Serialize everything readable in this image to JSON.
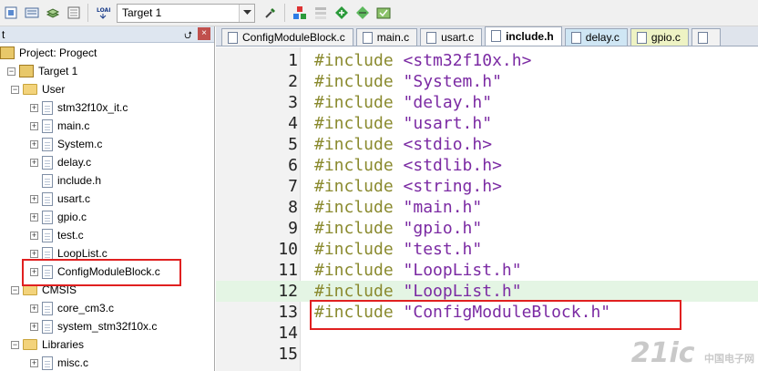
{
  "toolbar": {
    "target_select": "Target 1"
  },
  "panel": {
    "title": "t",
    "pin": "⮍",
    "close": "×",
    "tree": [
      {
        "label": "Project: Progect",
        "level": 0,
        "kind": "project",
        "exp": ""
      },
      {
        "label": "Target 1",
        "level": 1,
        "kind": "project",
        "exp": "−"
      },
      {
        "label": "User",
        "level": 2,
        "kind": "folder",
        "exp": "−"
      },
      {
        "label": "stm32f10x_it.c",
        "level": 3,
        "kind": "file",
        "exp": "+"
      },
      {
        "label": "main.c",
        "level": 3,
        "kind": "file",
        "exp": "+"
      },
      {
        "label": "System.c",
        "level": 3,
        "kind": "file",
        "exp": "+"
      },
      {
        "label": "delay.c",
        "level": 3,
        "kind": "file",
        "exp": "+"
      },
      {
        "label": "include.h",
        "level": 3,
        "kind": "file",
        "exp": ""
      },
      {
        "label": "usart.c",
        "level": 3,
        "kind": "file",
        "exp": "+"
      },
      {
        "label": "gpio.c",
        "level": 3,
        "kind": "file",
        "exp": "+"
      },
      {
        "label": "test.c",
        "level": 3,
        "kind": "file",
        "exp": "+"
      },
      {
        "label": "LoopList.c",
        "level": 3,
        "kind": "file",
        "exp": "+"
      },
      {
        "label": "ConfigModuleBlock.c",
        "level": 3,
        "kind": "file",
        "exp": "+"
      },
      {
        "label": "CMSIS",
        "level": 2,
        "kind": "folder",
        "exp": "−"
      },
      {
        "label": "core_cm3.c",
        "level": 3,
        "kind": "file",
        "exp": "+"
      },
      {
        "label": "system_stm32f10x.c",
        "level": 3,
        "kind": "file",
        "exp": "+"
      },
      {
        "label": "Libraries",
        "level": 2,
        "kind": "folder",
        "exp": "−"
      },
      {
        "label": "misc.c",
        "level": 3,
        "kind": "file",
        "exp": "+"
      }
    ]
  },
  "tabs": [
    {
      "label": "ConfigModuleBlock.c",
      "color": "#f2f2f2",
      "active": false
    },
    {
      "label": "main.c",
      "color": "#f2f2f2",
      "active": false
    },
    {
      "label": "usart.c",
      "color": "#f2f2f2",
      "active": false
    },
    {
      "label": "include.h",
      "color": "#ffffff",
      "active": true
    },
    {
      "label": "delay.c",
      "color": "#cfe6f4",
      "active": false
    },
    {
      "label": "gpio.c",
      "color": "#eef3c4",
      "active": false
    },
    {
      "label": "",
      "color": "#f2f2f2",
      "active": false
    }
  ],
  "editor": {
    "current_line": 12,
    "lines": [
      {
        "n": "1",
        "kw": "#include",
        "arg": " <stm32f10x.h>"
      },
      {
        "n": "2",
        "kw": "#include",
        "arg": " \"System.h\""
      },
      {
        "n": "3",
        "kw": "#include",
        "arg": " \"delay.h\""
      },
      {
        "n": "4",
        "kw": "#include",
        "arg": " \"usart.h\""
      },
      {
        "n": "5",
        "kw": "#include",
        "arg": " <stdio.h>"
      },
      {
        "n": "6",
        "kw": "#include",
        "arg": " <stdlib.h>"
      },
      {
        "n": "7",
        "kw": "#include",
        "arg": " <string.h>"
      },
      {
        "n": "8",
        "kw": "#include",
        "arg": " \"main.h\""
      },
      {
        "n": "9",
        "kw": "#include",
        "arg": " \"gpio.h\""
      },
      {
        "n": "10",
        "kw": "#include",
        "arg": " \"test.h\""
      },
      {
        "n": "11",
        "kw": "#include",
        "arg": " \"LoopList.h\""
      },
      {
        "n": "12",
        "kw": "#include",
        "arg": " \"LoopList.h\""
      },
      {
        "n": "13",
        "kw": "#include",
        "arg": " \"ConfigModuleBlock.h\""
      },
      {
        "n": "14",
        "kw": "",
        "arg": ""
      },
      {
        "n": "15",
        "kw": "",
        "arg": ""
      }
    ]
  },
  "watermark": {
    "main": "21ic",
    "sub": "中国电子网"
  },
  "colors": {
    "highlight": "#e02020",
    "keyword": "#8a8a2e",
    "string": "#7b2aa3"
  }
}
